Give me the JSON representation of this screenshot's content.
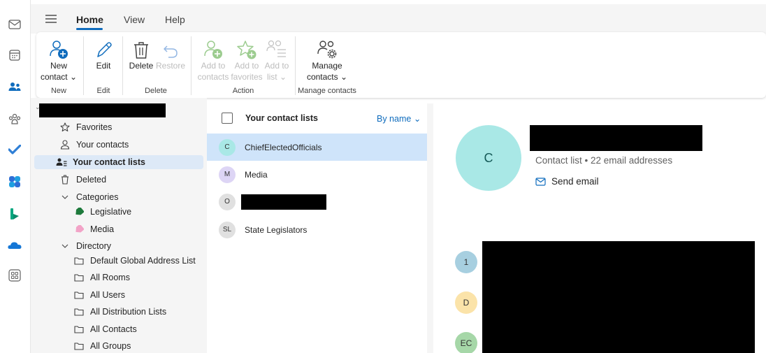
{
  "rail": {
    "icons": [
      "mail-icon",
      "calendar-icon",
      "people-icon",
      "groups-icon",
      "todo-icon",
      "copilot-icon",
      "bookings-icon",
      "onedrive-icon",
      "apps-icon"
    ]
  },
  "tabs": [
    {
      "label": "Home",
      "active": true
    },
    {
      "label": "View",
      "active": false
    },
    {
      "label": "Help",
      "active": false
    }
  ],
  "ribbon": {
    "new_contact": {
      "line1": "New",
      "line2": "contact"
    },
    "edit": "Edit",
    "delete": "Delete",
    "restore": "Restore",
    "add_contacts": {
      "line1": "Add to",
      "line2": "contacts"
    },
    "add_favorites": {
      "line1": "Add to",
      "line2": "favorites"
    },
    "add_list": {
      "line1": "Add to",
      "line2": "list"
    },
    "manage": {
      "line1": "Manage",
      "line2": "contacts"
    },
    "groups": {
      "new": "New",
      "edit": "Edit",
      "delete": "Delete",
      "action": "Action",
      "manage": "Manage contacts"
    }
  },
  "nav": {
    "favorites": "Favorites",
    "your_contacts": "Your contacts",
    "your_contact_lists": "Your contact lists",
    "deleted": "Deleted",
    "categories": "Categories",
    "legislative": "Legislative",
    "media": "Media",
    "directory": "Directory",
    "default_gal": "Default Global Address List",
    "all_rooms": "All Rooms",
    "all_users": "All Users",
    "all_dl": "All Distribution Lists",
    "all_contacts": "All Contacts",
    "all_groups": "All Groups"
  },
  "list": {
    "header": "Your contact lists",
    "sort": "By name",
    "rows": [
      {
        "initials": "C",
        "name": "ChiefElectedOfficials",
        "color": "#a9e8e6"
      },
      {
        "initials": "M",
        "name": "Media",
        "color": "#ddd5f5"
      },
      {
        "initials": "O",
        "name": "",
        "color": "#e0e0e0"
      },
      {
        "initials": "SL",
        "name": "State Legislators",
        "color": "#e0e0e0"
      }
    ]
  },
  "detail": {
    "avatar": "C",
    "subtitle": "Contact list • 22 email addresses",
    "send_email": "Send email",
    "members": [
      {
        "initials": "1",
        "color": "#a7cfe0"
      },
      {
        "initials": "D",
        "color": "#fbe3a9"
      },
      {
        "initials": "EC",
        "color": "#a6d7a8"
      }
    ]
  },
  "colors": {
    "accent": "#0f6cbd",
    "selected_row": "#cfe4fa",
    "selected_nav": "#dde9f7"
  }
}
